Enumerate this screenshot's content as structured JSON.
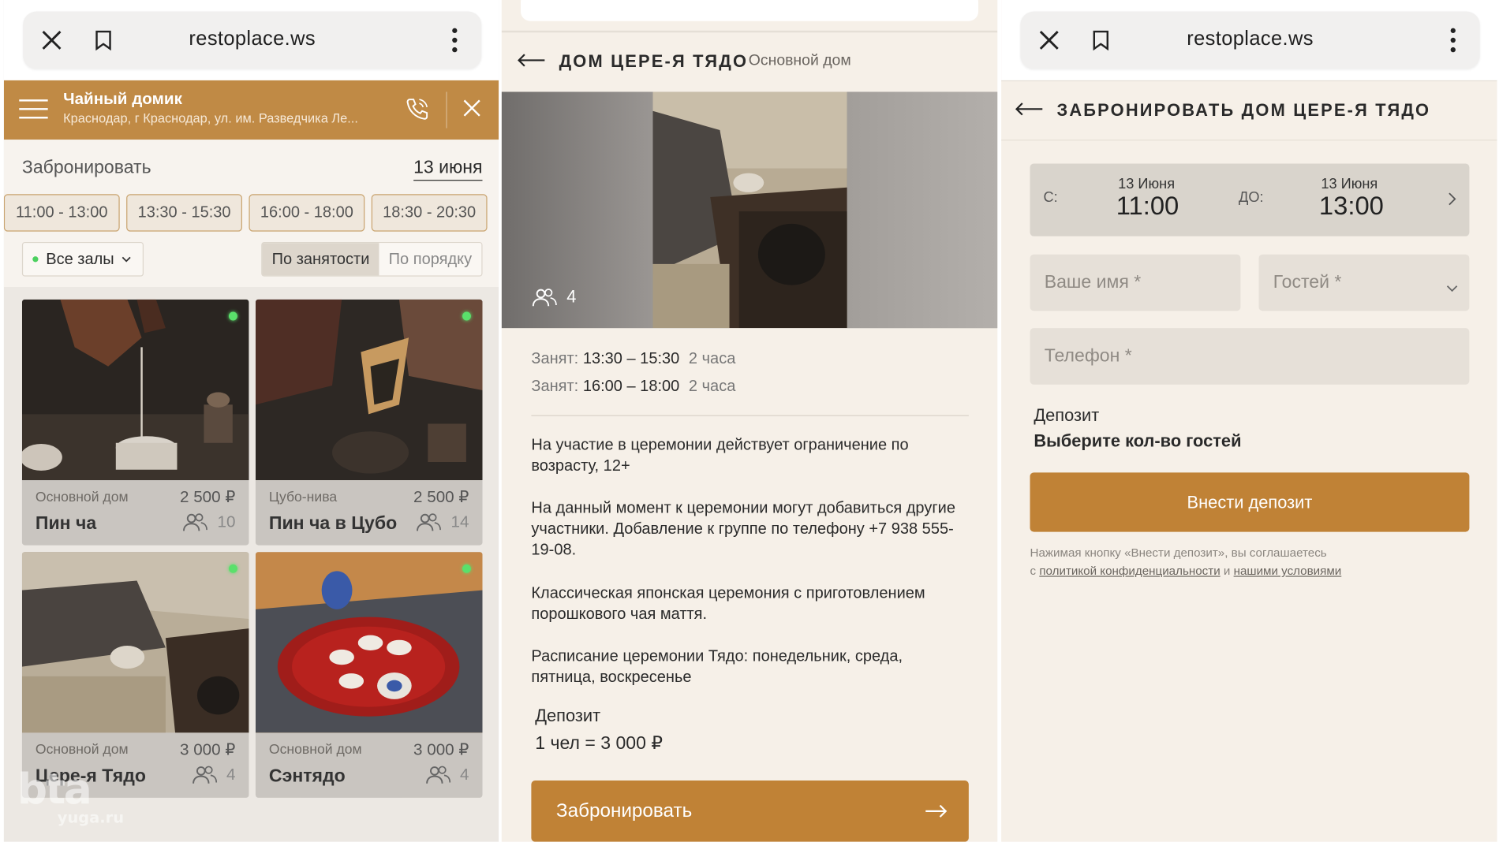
{
  "browser": {
    "url": "restoplace.ws"
  },
  "restaurant": {
    "name": "Чайный домик",
    "address": "Краснодар, г Краснодар, ул. им. Разведчика Ле..."
  },
  "booking": {
    "label": "Забронировать",
    "date": "13 июня",
    "slots": [
      "11:00 - 13:00",
      "13:30 - 15:30",
      "16:00 - 18:00",
      "18:30 - 20:30"
    ],
    "filter": "Все залы",
    "sort": {
      "active": "По занятости",
      "inactive": "По порядку"
    }
  },
  "cards": [
    {
      "hall": "Основной дом",
      "price": "2 500 ₽",
      "name": "Пин ча",
      "capacity": "10",
      "status": "free"
    },
    {
      "hall": "Цубо-нива",
      "price": "2 500 ₽",
      "name": "Пин ча в Цубо",
      "capacity": "14",
      "status": "free"
    },
    {
      "hall": "Основной дом",
      "price": "3 000 ₽",
      "name": "Цере-я Тядо",
      "capacity": "4",
      "status": "free"
    },
    {
      "hall": "Основной дом",
      "price": "3 000 ₽",
      "name": "Сэнтядо",
      "capacity": "4",
      "status": "free"
    }
  ],
  "watermark": {
    "big": "bta",
    "small": "yuga.ru"
  },
  "detail": {
    "title": "ДОМ ЦЕРЕ-Я ТЯДО",
    "subtitle": "Основной дом",
    "guests": "4",
    "busy": [
      {
        "label": "Занят:",
        "time": "13:30 – 15:30",
        "duration": "2 часа"
      },
      {
        "label": "Занят:",
        "time": "16:00 – 18:00",
        "duration": "2 часа"
      }
    ],
    "paragraphs": [
      "На участие в церемонии действует ограничение по возрасту, 12+",
      "На данный момент к церемонии могут добавиться другие участники. Добавление к группе по телефону +7 938 555-19-08.",
      "Классическая японская церемония с приготовлением порошкового чая маття.",
      "Расписание церемонии Тядо: понедельник, среда, пятница, воскресенье"
    ],
    "deposit_label": "Депозит",
    "deposit_prefix": "1 чел = ",
    "deposit_amount": "3 000 ₽",
    "book_button": "Забронировать"
  },
  "form": {
    "title": "ЗАБРОНИРОВАТЬ ДОМ ЦЕРЕ-Я ТЯДО",
    "from_label": "С:",
    "from_date": "13 Июня",
    "from_time": "11:00",
    "to_label": "ДО:",
    "to_date": "13 Июня",
    "to_time": "13:00",
    "name_placeholder": "Ваше имя *",
    "guests_placeholder": "Гостей *",
    "phone_placeholder": "Телефон *",
    "deposit_label": "Депозит",
    "deposit_hint": "Выберите кол-во гостей",
    "deposit_button": "Внести депозит",
    "terms_text": "Нажимая кнопку «Внести депозит», вы соглашаетесь",
    "terms_prefix": "с ",
    "terms_link1": "политикой конфиденциальности",
    "terms_and": " и ",
    "terms_link2": "нашими условиями"
  },
  "colors": {
    "accent": "#c08236",
    "header": "#c08a45",
    "status_free": "#5ae06b"
  }
}
